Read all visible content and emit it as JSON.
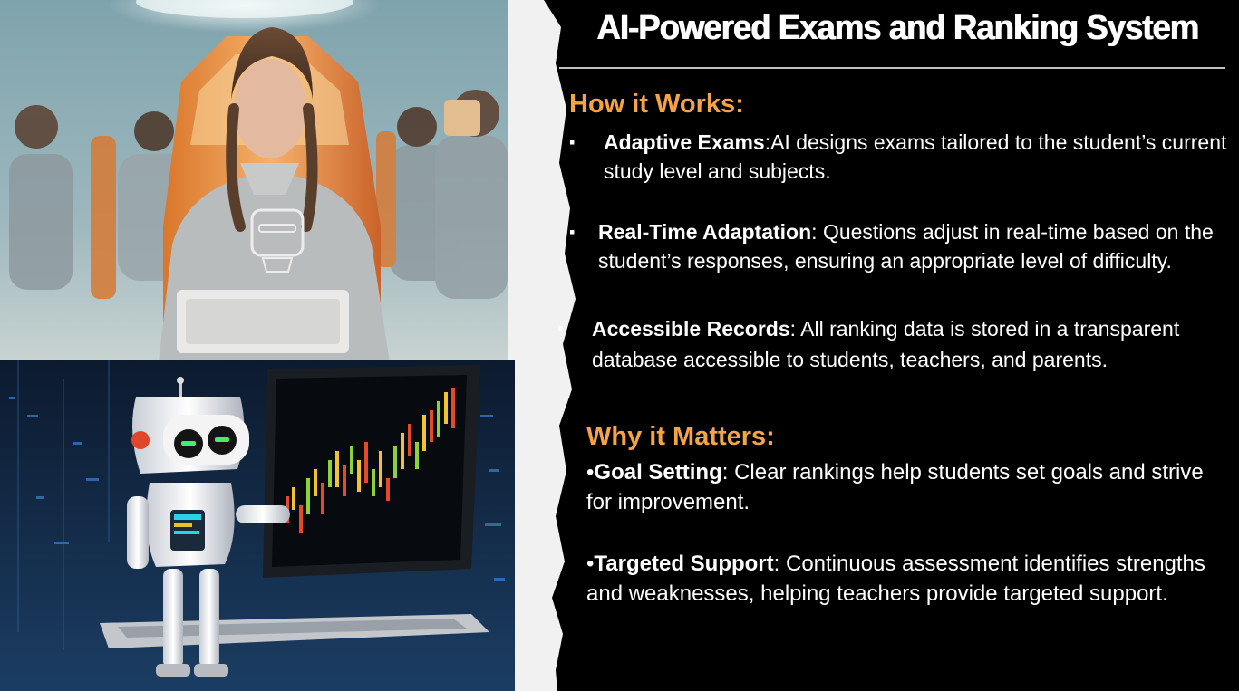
{
  "title": "AI-Powered Exams and Ranking System",
  "how_it_works": {
    "heading": "How it Works:",
    "items": [
      {
        "marker": "▪",
        "label": "Adaptive Exams",
        "sep": ":",
        "text": "AI designs exams tailored to the student’s current study level and subjects."
      },
      {
        "marker": "▪",
        "label": "Real-Time Adaptation",
        "sep": ": ",
        "text": "Questions adjust in real-time based on the student’s responses, ensuring an appropriate level of difficulty."
      },
      {
        "marker": "▪",
        "label": "Accessible Records",
        "sep": ": ",
        "text": "All ranking data is stored in a transparent database accessible to students, teachers, and parents."
      }
    ]
  },
  "why_it_matters": {
    "heading": "Why it Matters:",
    "items": [
      {
        "marker": "•",
        "label": "Goal Setting",
        "sep": ": ",
        "text": "Clear rankings help students set goals and strive for improvement."
      },
      {
        "marker": "•",
        "label": "Targeted Support",
        "sep": ": ",
        "text": "Continuous assessment identifies strengths and weaknesses, helping teachers provide targeted support."
      }
    ]
  },
  "colors": {
    "panel_bg": "#000000",
    "heading": "#f5a347",
    "text": "#ffffff",
    "page_bg": "#f2f1f1"
  },
  "images": [
    "classroom-students-photo",
    "robot-laptop-stock-chart-photo"
  ]
}
